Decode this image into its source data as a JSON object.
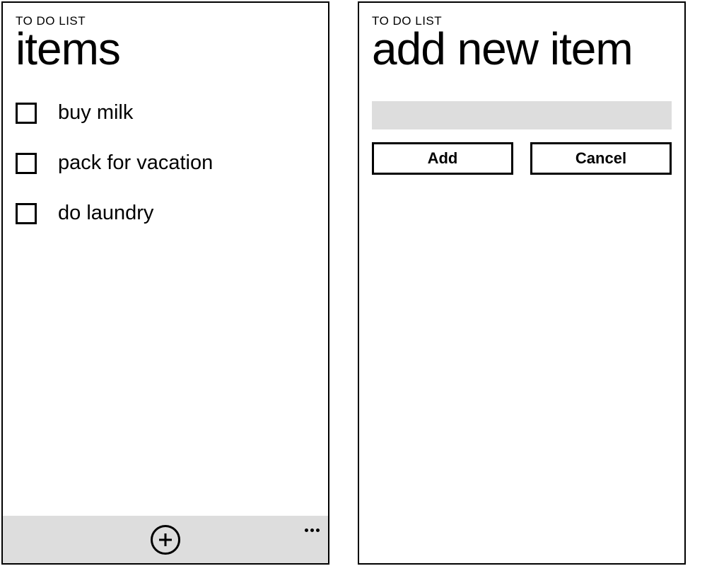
{
  "screen_items": {
    "app_title": "TO DO LIST",
    "page_title": "items",
    "items": [
      {
        "label": "buy milk",
        "checked": false
      },
      {
        "label": "pack for vacation",
        "checked": false
      },
      {
        "label": "do laundry",
        "checked": false
      }
    ],
    "appbar": {
      "add_icon": "plus-icon",
      "more_icon": "more-icon"
    }
  },
  "screen_add": {
    "app_title": "TO DO LIST",
    "page_title": "add new item",
    "input_value": "",
    "buttons": {
      "add": "Add",
      "cancel": "Cancel"
    }
  }
}
